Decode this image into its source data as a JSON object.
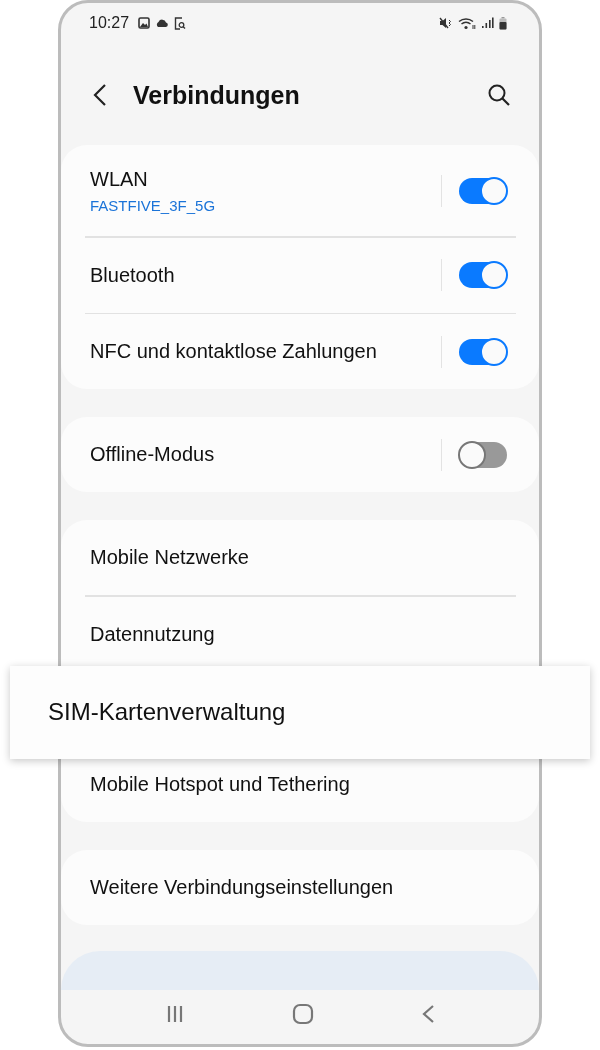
{
  "status_bar": {
    "time": "10:27"
  },
  "header": {
    "title": "Verbindungen"
  },
  "groups": [
    {
      "items": [
        {
          "kind": "toggle",
          "label": "WLAN",
          "sublabel": "FASTFIVE_3F_5G",
          "on": true
        },
        {
          "kind": "toggle",
          "label": "Bluetooth",
          "on": true
        },
        {
          "kind": "toggle",
          "label": "NFC und kontaktlose Zahlungen",
          "on": true
        }
      ]
    },
    {
      "items": [
        {
          "kind": "toggle",
          "label": "Offline-Modus",
          "on": false
        }
      ]
    },
    {
      "items": [
        {
          "kind": "link",
          "label": "Mobile Netzwerke"
        },
        {
          "kind": "link",
          "label": "Datennutzung"
        },
        {
          "kind": "callout",
          "label": "SIM-Kartenverwaltung"
        },
        {
          "kind": "link",
          "label": "Mobile Hotspot und Tethering"
        }
      ]
    },
    {
      "items": [
        {
          "kind": "link",
          "label": "Weitere Verbindungseinstellungen"
        }
      ]
    }
  ]
}
